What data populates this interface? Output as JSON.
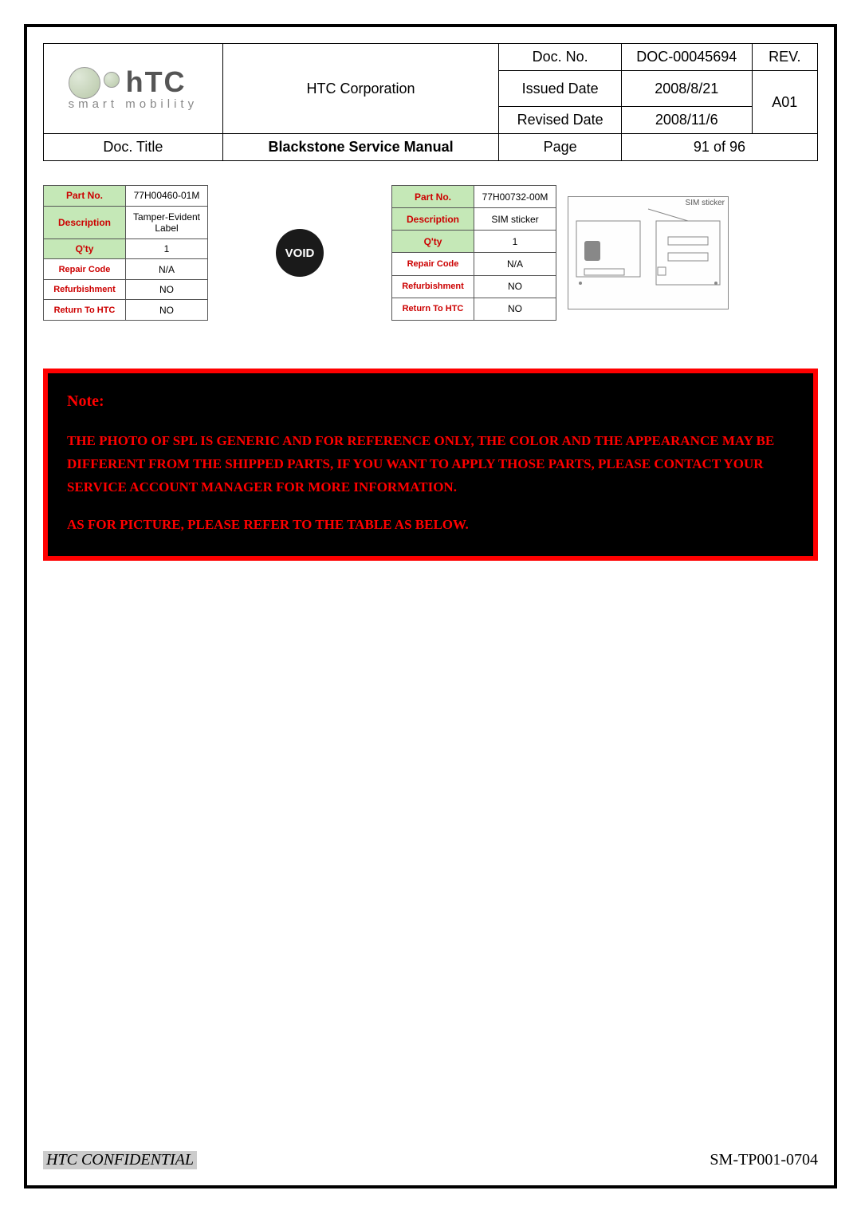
{
  "header": {
    "company": "HTC Corporation",
    "logo_text": "hTC",
    "logo_tagline": "smart mobility",
    "doc_no_label": "Doc. No.",
    "doc_no": "DOC-00045694",
    "rev_label": "REV.",
    "issued_label": "Issued Date",
    "issued_date": "2008/8/21",
    "rev": "A01",
    "revised_label": "Revised Date",
    "revised_date": "2008/11/6",
    "title_label": "Doc. Title",
    "title": "Blackstone Service Manual",
    "page_label": "Page",
    "page_value": "91  of  96"
  },
  "parts": [
    {
      "labels": {
        "partno": "Part No.",
        "desc": "Description",
        "qty": "Q'ty",
        "repair": "Repair Code",
        "refurb": "Refurbishment",
        "return": "Return To HTC"
      },
      "partno": "77H00460-01M",
      "desc": "Tamper-Evident Label",
      "qty": "1",
      "repair": "N/A",
      "refurb": "NO",
      "return": "NO",
      "image_text": "VOID"
    },
    {
      "labels": {
        "partno": "Part No.",
        "desc": "Description",
        "qty": "Q'ty",
        "repair": "Repair Code",
        "refurb": "Refurbishment",
        "return": "Return To HTC"
      },
      "partno": "77H00732-00M",
      "desc": "SIM sticker",
      "qty": "1",
      "repair": "N/A",
      "refurb": "NO",
      "return": "NO",
      "image_label": "SIM sticker"
    }
  ],
  "note": {
    "title": "Note:",
    "body1": "THE PHOTO OF SPL IS GENERIC AND FOR REFERENCE ONLY, THE COLOR AND THE APPEARANCE MAY BE DIFFERENT FROM THE SHIPPED PARTS, IF YOU WANT TO APPLY THOSE PARTS, PLEASE CONTACT YOUR SERVICE ACCOUNT MANAGER FOR MORE INFORMATION.",
    "body2": "AS FOR PICTURE, PLEASE REFER TO THE TABLE AS BELOW."
  },
  "footer": {
    "confidential": "HTC CONFIDENTIAL",
    "docref": "SM-TP001-0704"
  }
}
